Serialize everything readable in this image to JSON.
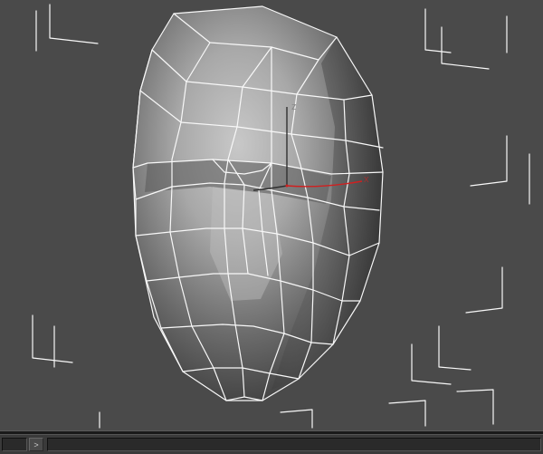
{
  "viewport": {
    "axis_z_label": "z",
    "axis_x_label": "x",
    "gizmo_color_x": "#d02020",
    "gizmo_color_z": "#303030",
    "wire_color": "#f8f8f8",
    "bg_color": "#4a4a4a"
  },
  "bottom": {
    "frame_value": "",
    "step_glyph": ">",
    "coord_value": ""
  }
}
